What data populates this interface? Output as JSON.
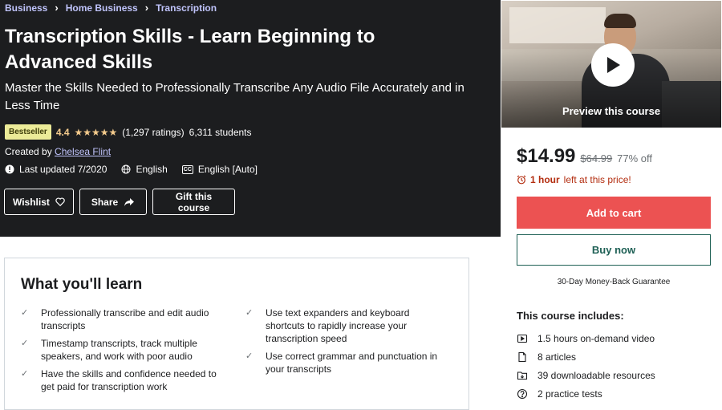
{
  "breadcrumbs": [
    "Business",
    "Home Business",
    "Transcription"
  ],
  "course": {
    "title": "Transcription Skills - Learn Beginning to Advanced Skills",
    "subtitle": "Master the Skills Needed to Professionally Transcribe Any Audio File Accurately and in Less Time",
    "badge": "Bestseller",
    "rating": "4.4",
    "rating_stars": 4.4,
    "ratings_count": "(1,297 ratings)",
    "students": "6,311 students",
    "created_by_label": "Created by",
    "instructor": "Chelsea Flint",
    "last_updated": "Last updated 7/2020",
    "language": "English",
    "captions": "English [Auto]",
    "captions_icon_text": "CC"
  },
  "actions": {
    "wishlist": "Wishlist",
    "share": "Share",
    "gift": "Gift this course"
  },
  "sidebar": {
    "preview_label": "Preview this course",
    "price": "$14.99",
    "original_price": "$64.99",
    "discount": "77% off",
    "timer_bold": "1 hour",
    "timer_rest": "left at this price!",
    "add_to_cart": "Add to cart",
    "buy_now": "Buy now",
    "guarantee": "30-Day Money-Back Guarantee",
    "includes_title": "This course includes:",
    "includes": [
      {
        "icon": "video-icon",
        "label": "1.5 hours on-demand video"
      },
      {
        "icon": "file-icon",
        "label": "8 articles"
      },
      {
        "icon": "folder-download-icon",
        "label": "39 downloadable resources"
      },
      {
        "icon": "question-icon",
        "label": "2 practice tests"
      }
    ]
  },
  "learn": {
    "title": "What you'll learn",
    "left": [
      "Professionally transcribe and edit audio transcripts",
      "Timestamp transcripts, track multiple speakers, and work with poor audio",
      "Have the skills and confidence needed to get paid for transcription work"
    ],
    "right": [
      "Use text expanders and keyboard shortcuts to rapidly increase your transcription speed",
      "Use correct grammar and punctuation in your transcripts"
    ]
  },
  "colors": {
    "hero_bg": "#1c1d1f",
    "link": "#c0c4fc",
    "star": "#f3ca8c",
    "cart": "#ec5252",
    "buy": "#1e6055",
    "alert": "#b32d0f"
  }
}
